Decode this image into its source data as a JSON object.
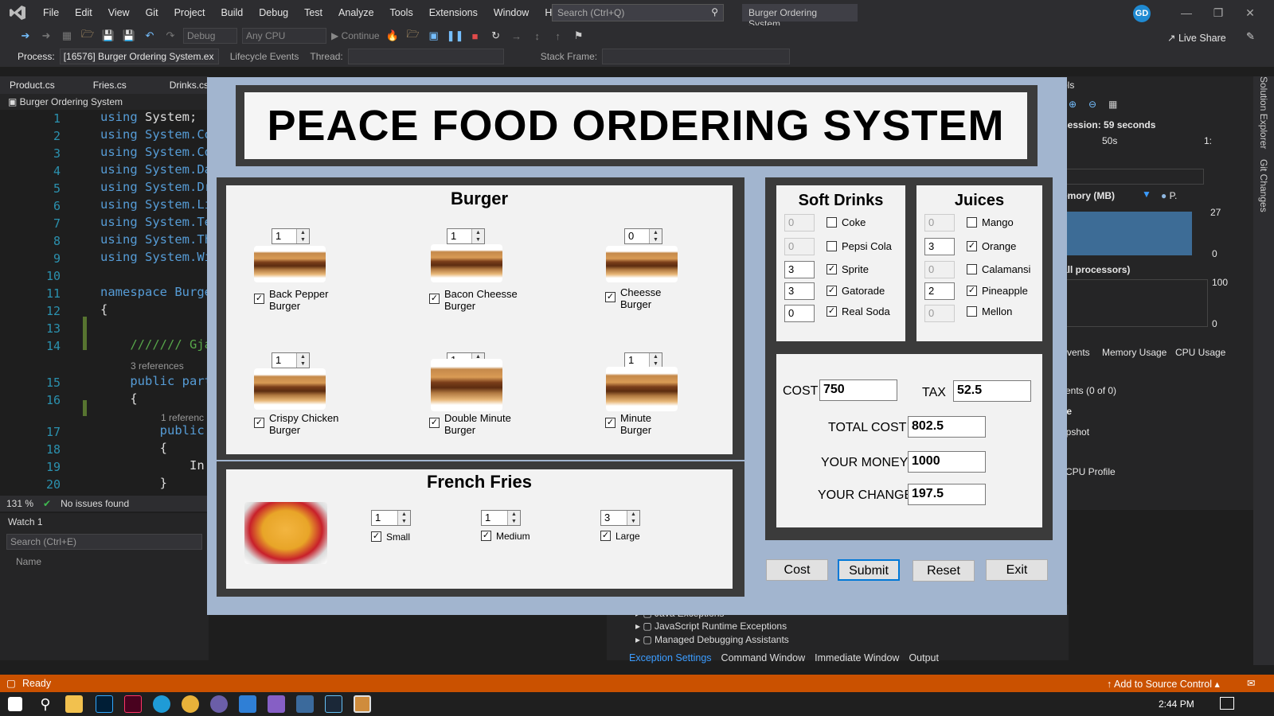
{
  "menubar": {
    "items": [
      "File",
      "Edit",
      "View",
      "Git",
      "Project",
      "Build",
      "Debug",
      "Test",
      "Analyze",
      "Tools",
      "Extensions",
      "Window",
      "Help"
    ],
    "search_placeholder": "Search (Ctrl+Q)",
    "window_title": "Burger Ordering System",
    "avatar": "GD"
  },
  "toolbar": {
    "config": "Debug",
    "platform": "Any CPU",
    "continue": "Continue",
    "live_share": "Live Share"
  },
  "toolbar2": {
    "process_label": "Process:",
    "process": "[16576] Burger Ordering System.ex",
    "lifecycle": "Lifecycle Events",
    "thread": "Thread:",
    "stack_frame": "Stack Frame:"
  },
  "tabs": [
    "Product.cs",
    "Fries.cs",
    "Drinks.cs"
  ],
  "file_header": "Burger Ordering System",
  "editor": {
    "lines": [
      {
        "n": "1",
        "code": "using System;"
      },
      {
        "n": "2",
        "code": "using System.Co"
      },
      {
        "n": "3",
        "code": "using System.Co"
      },
      {
        "n": "4",
        "code": "using System.Da"
      },
      {
        "n": "5",
        "code": "using System.Dr"
      },
      {
        "n": "6",
        "code": "using System.Li"
      },
      {
        "n": "7",
        "code": "using System.Te"
      },
      {
        "n": "8",
        "code": "using System.Th"
      },
      {
        "n": "9",
        "code": "using System.Wi"
      },
      {
        "n": "10",
        "code": ""
      },
      {
        "n": "11",
        "code": "namespace Burge"
      },
      {
        "n": "12",
        "code": "{"
      },
      {
        "n": "13",
        "code": ""
      },
      {
        "n": "14",
        "code": "    /////// Gja"
      },
      {
        "n": "15",
        "code": "    public part"
      },
      {
        "n": "16",
        "code": "    {"
      },
      {
        "n": "17",
        "code": "        public"
      },
      {
        "n": "18",
        "code": "        {"
      },
      {
        "n": "19",
        "code": "            In:"
      },
      {
        "n": "20",
        "code": "        }"
      }
    ],
    "refs1": "3 references",
    "refs2": "1 referenc"
  },
  "statusline": {
    "zoom": "131 %",
    "issues": "No issues found"
  },
  "watch": {
    "title": "Watch 1",
    "search": "Search (Ctrl+E)",
    "col_name": "Name"
  },
  "diag": {
    "title": "ols",
    "session": "session: 59 seconds",
    "timeline_50s": "50s",
    "timeline_1": "1:",
    "memory": "emory (MB)",
    "p_label": "P.",
    "mem_max": "27",
    "mem_min": "0",
    "cpu": "all processors)",
    "cpu_max": "100",
    "cpu_min": "0",
    "tabs": [
      "Events",
      "Memory Usage",
      "CPU Usage"
    ],
    "events": "vents (0 of 0)",
    "usage": "ge",
    "snapshot": "apshot",
    "cpu_profile": "CPU Profile"
  },
  "solution_tabs": [
    "Solution Explorer",
    "Git Changes"
  ],
  "exceptions": {
    "items": [
      "Java Exceptions",
      "JavaScript Runtime Exceptions",
      "Managed Debugging Assistants"
    ],
    "tabs": [
      "Exception Settings",
      "Command Window",
      "Immediate Window",
      "Output"
    ]
  },
  "statusbar": {
    "ready": "Ready",
    "source_control": "Add to Source Control"
  },
  "clock": "2:44 PM",
  "form": {
    "title": "PEACE FOOD ORDERING SYSTEM",
    "burger": {
      "title": "Burger",
      "items": [
        {
          "qty": "1",
          "label1": "Back Pepper",
          "label2": "Burger",
          "checked": "✓"
        },
        {
          "qty": "1",
          "label1": "Bacon Cheesse",
          "label2": "Burger",
          "checked": "✓"
        },
        {
          "qty": "0",
          "label1": "Cheesse",
          "label2": "Burger",
          "checked": "✓"
        },
        {
          "qty": "1",
          "label1": "Crispy Chicken",
          "label2": "Burger",
          "checked": "✓"
        },
        {
          "qty": "1",
          "label1": "Double Minute",
          "label2": "Burger",
          "checked": "✓"
        },
        {
          "qty": "1",
          "label1": "Minute",
          "label2": "Burger",
          "checked": "✓"
        }
      ]
    },
    "fries": {
      "title": "French Fries",
      "items": [
        {
          "qty": "1",
          "label": "Small",
          "checked": "✓"
        },
        {
          "qty": "1",
          "label": "Medium",
          "checked": "✓"
        },
        {
          "qty": "3",
          "label": "Large",
          "checked": "✓"
        }
      ]
    },
    "soft_drinks": {
      "title": "Soft Drinks",
      "items": [
        {
          "qty": "0",
          "label": "Coke",
          "checked": ""
        },
        {
          "qty": "0",
          "label": "Pepsi Cola",
          "checked": ""
        },
        {
          "qty": "3",
          "label": "Sprite",
          "checked": "✓"
        },
        {
          "qty": "3",
          "label": "Gatorade",
          "checked": "✓"
        },
        {
          "qty": "0",
          "label": "Real Soda",
          "checked": "✓"
        }
      ]
    },
    "juices": {
      "title": "Juices",
      "items": [
        {
          "qty": "0",
          "label": "Mango",
          "checked": ""
        },
        {
          "qty": "3",
          "label": "Orange",
          "checked": "✓"
        },
        {
          "qty": "0",
          "label": "Calamansi",
          "checked": ""
        },
        {
          "qty": "2",
          "label": "Pineapple",
          "checked": "✓"
        },
        {
          "qty": "0",
          "label": "Mellon",
          "checked": ""
        }
      ]
    },
    "totals": {
      "cost_label": "COST",
      "cost": "750",
      "tax_label": "TAX",
      "tax": "52.5",
      "total_label": "TOTAL COST",
      "total": "802.5",
      "money_label": "YOUR MONEY",
      "money": "1000",
      "change_label": "YOUR CHANGE",
      "change": "197.5"
    },
    "buttons": {
      "cost": "Cost",
      "submit": "Submit",
      "reset": "Reset",
      "exit": "Exit"
    }
  }
}
